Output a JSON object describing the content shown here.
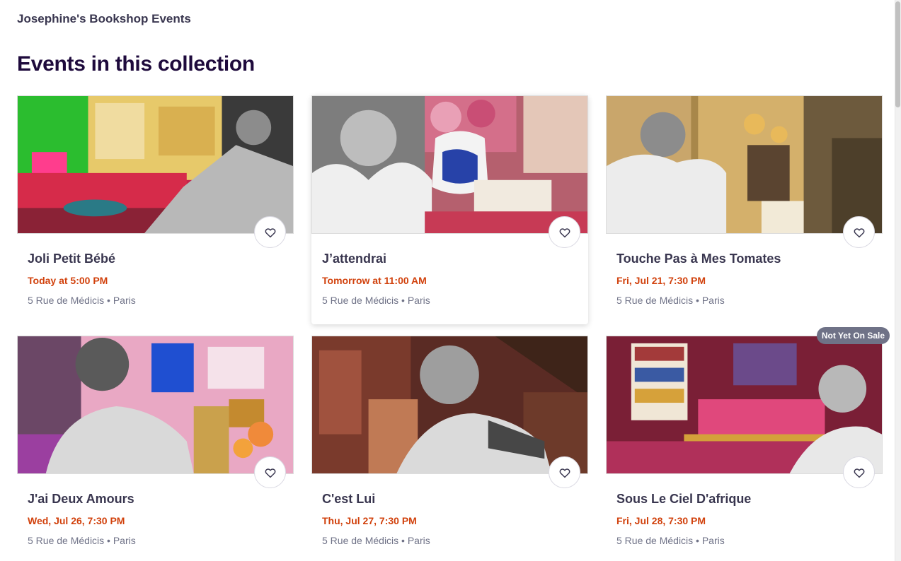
{
  "organizer": {
    "name": "Josephine's Bookshop Events"
  },
  "section": {
    "title": "Events in this collection"
  },
  "events": [
    {
      "title": "Joli Petit Bébé",
      "date": "Today at 5:00 PM",
      "venue": "5 Rue de Médicis • Paris"
    },
    {
      "title": "J’attendrai",
      "date": "Tomorrow at 11:00 AM",
      "venue": "5 Rue de Médicis • Paris"
    },
    {
      "title": "Touche Pas à Mes Tomates",
      "date": "Fri, Jul 21, 7:30 PM",
      "venue": "5 Rue de Médicis • Paris"
    },
    {
      "title": "J'ai Deux Amours",
      "date": "Wed, Jul 26, 7:30 PM",
      "venue": "5 Rue de Médicis • Paris"
    },
    {
      "title": "C'est Lui",
      "date": "Thu, Jul 27, 7:30 PM",
      "venue": "5 Rue de Médicis • Paris"
    },
    {
      "title": "Sous Le Ciel D'afrique",
      "date": "Fri, Jul 28, 7:30 PM",
      "venue": "5 Rue de Médicis • Paris",
      "badge": "Not Yet On Sale"
    }
  ],
  "icons": {
    "favorite": "heart-outline-icon"
  },
  "colors": {
    "date": "#d1410c",
    "heading": "#1e0a3c",
    "text": "#39364f",
    "muted": "#6f7287",
    "badge": "#6f7287"
  }
}
